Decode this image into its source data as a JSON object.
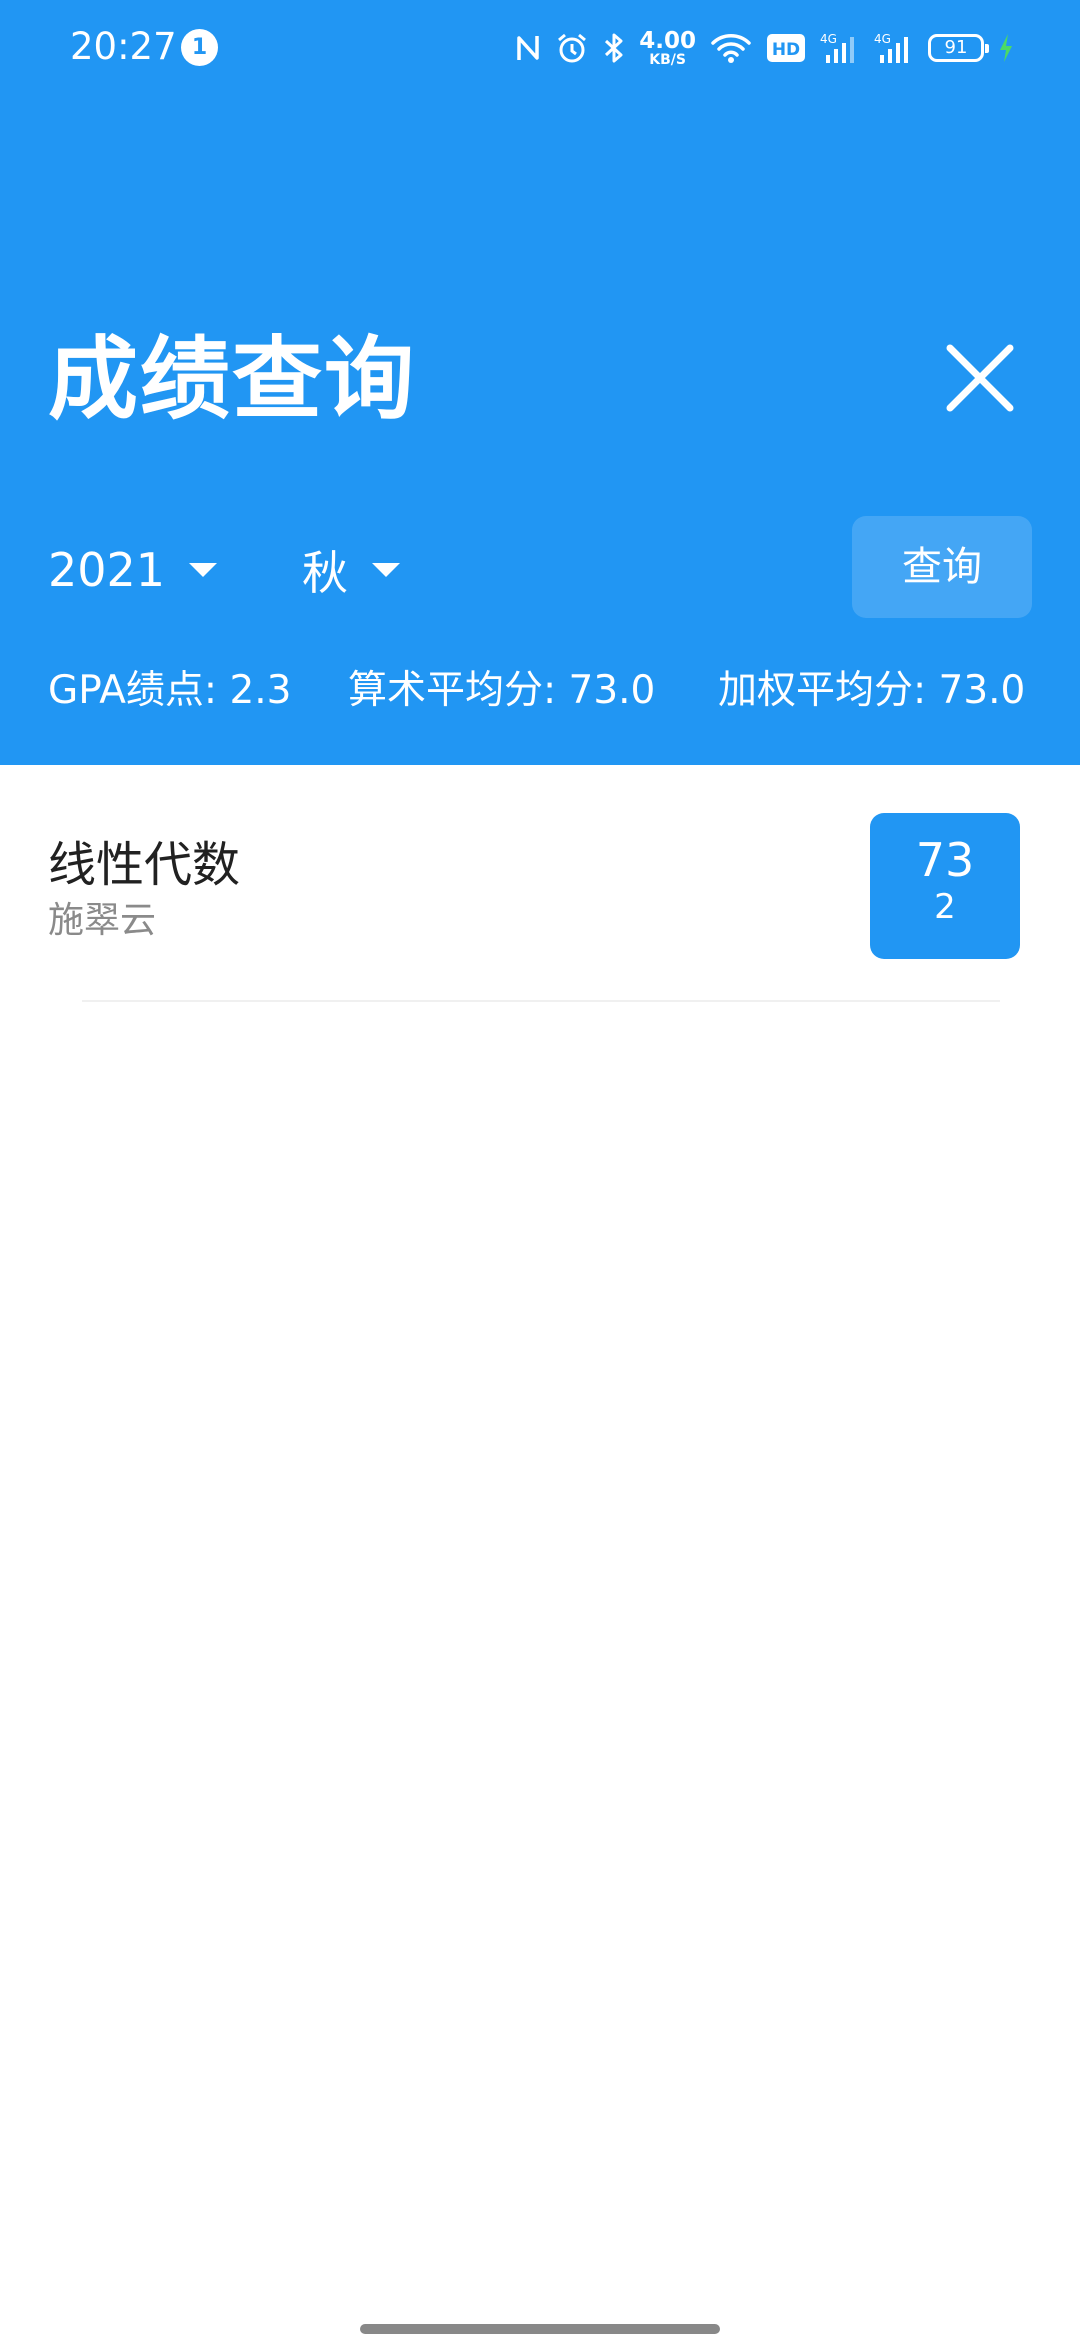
{
  "status_bar": {
    "time": "20:27",
    "notification_count": "1",
    "net_speed_value": "4.00",
    "net_speed_unit": "KB/S",
    "hd_label": "HD",
    "signal1_label": "4G",
    "signal2_label": "4G",
    "battery": "91",
    "icons": [
      "nfc-icon",
      "alarm-icon",
      "bluetooth-icon",
      "wifi-icon",
      "hd-icon",
      "signal-icon",
      "battery-icon",
      "charging-icon"
    ]
  },
  "header": {
    "title": "成绩查询",
    "close_icon": "close-icon"
  },
  "filters": {
    "year": "2021",
    "season": "秋",
    "query_button": "查询"
  },
  "stats": {
    "gpa": "GPA绩点: 2.3",
    "arithmetic_avg": "算术平均分: 73.0",
    "weighted_avg": "加权平均分: 73.0"
  },
  "courses": [
    {
      "name": "线性代数",
      "teacher": "施翠云",
      "score": "73",
      "credit": "2"
    }
  ],
  "colors": {
    "primary": "#2196F3",
    "background": "#ffffff",
    "text_primary": "#212121",
    "text_secondary": "#8a8a8a"
  }
}
